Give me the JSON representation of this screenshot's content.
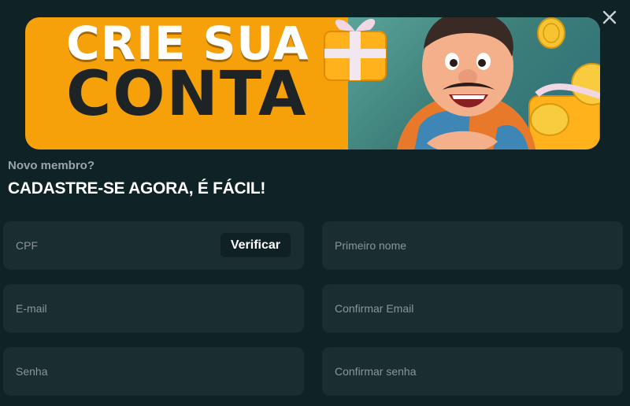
{
  "banner": {
    "title_line1": "CRIE SUA",
    "title_line2": "CONTA"
  },
  "header": {
    "subtitle": "Novo membro?",
    "heading": "CADASTRE-SE AGORA, É FÁCIL!"
  },
  "form": {
    "cpf_placeholder": "CPF",
    "verify_label": "Verificar",
    "first_name_placeholder": "Primeiro nome",
    "email_placeholder": "E-mail",
    "confirm_email_placeholder": "Confirmar Email",
    "password_placeholder": "Senha",
    "confirm_password_placeholder": "Confirmar senha"
  },
  "icons": {
    "close": "close-icon"
  },
  "colors": {
    "background": "#0f2327",
    "field_background": "#1a2e31",
    "banner_orange": "#f7a10a",
    "verify_button_bg": "#0f2125"
  }
}
